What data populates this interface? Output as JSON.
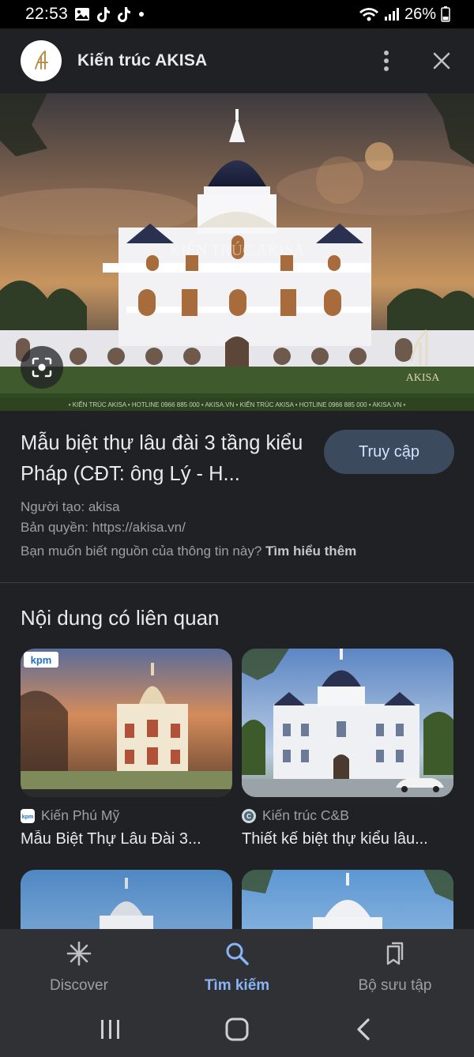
{
  "status_bar": {
    "time": "22:53",
    "battery": "26%"
  },
  "header": {
    "site_name": "Kiến trúc AKISA",
    "logo_icon": "akisa-logo-icon",
    "menu_icon": "more-vert-icon",
    "close_icon": "close-icon"
  },
  "hero": {
    "lens_icon": "google-lens-icon"
  },
  "image_info": {
    "title": "Mẫu biệt thự lâu đài 3 tầng kiểu Pháp (CĐT: ông Lý - H...",
    "visit_label": "Truy cập",
    "creator": "Người tạo: akisa",
    "copyright": "Bản quyền: https://akisa.vn/",
    "source_question": "Bạn muốn biết nguồn của thông tin này?",
    "learn_more": "Tìm hiểu thêm"
  },
  "related": {
    "heading": "Nội dung có liên quan",
    "items": [
      {
        "source": "Kiến Phú Mỹ",
        "title": "Mẫu Biệt Thự Lâu Đài 3..."
      },
      {
        "source": "Kiến trúc C&B",
        "title": "Thiết kế biệt thự kiểu lâu..."
      },
      {
        "source": "",
        "title": ""
      },
      {
        "source": "",
        "title": ""
      }
    ]
  },
  "bottom_nav": {
    "items": [
      {
        "label": "Discover",
        "icon": "discover-asterisk-icon",
        "active": false
      },
      {
        "label": "Tìm kiếm",
        "icon": "search-icon",
        "active": true
      },
      {
        "label": "Bộ sưu tập",
        "icon": "collections-icon",
        "active": false
      }
    ]
  },
  "colors": {
    "background": "#202124",
    "accent": "#8ab4f8",
    "button_bg": "#3c4a5d"
  }
}
